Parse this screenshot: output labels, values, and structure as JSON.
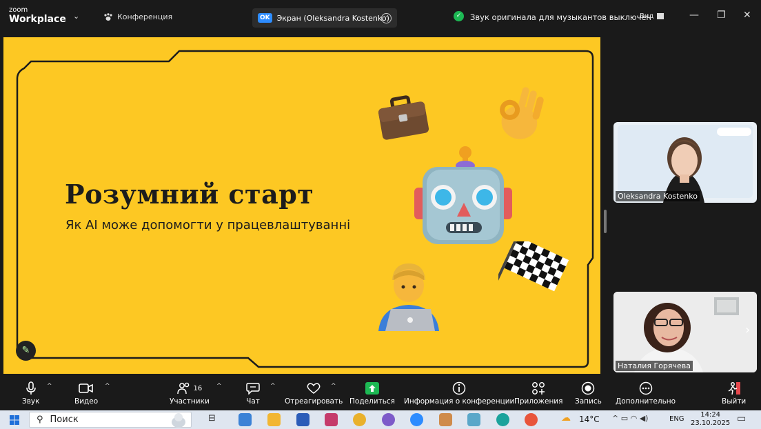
{
  "titlebar": {
    "brand_small": "zoom",
    "brand_big": "Workplace",
    "conference_label": "Конференция",
    "screen_badge": "OK",
    "screen_tab": "Экран (Oleksandra Kostenko)",
    "original_sound": "Звук оригинала для музыкантов выключен",
    "view_label": "Вид"
  },
  "slide": {
    "title": "Розумний старт",
    "subtitle": "Як AI може допомогти у працевлаштуванні"
  },
  "participants": [
    {
      "name": "Oleksandra Kostenko"
    },
    {
      "name": "Наталия Горячева"
    }
  ],
  "toolbar": {
    "audio": "Звук",
    "video": "Видео",
    "participants": "Участники",
    "participants_count": "16",
    "chat": "Чат",
    "react": "Отреагировать",
    "share": "Поделиться",
    "info": "Информация о конференции",
    "apps": "Приложения",
    "record": "Запись",
    "more": "Дополнительно",
    "leave": "Выйти"
  },
  "taskbar": {
    "search_placeholder": "Поиск",
    "weather": "14°C",
    "language": "ENG",
    "time": "14:24",
    "date": "23.10.2025"
  },
  "colors": {
    "slide_bg": "#fdc823",
    "accent_green": "#1db954",
    "zoom_blue": "#2d8cff",
    "leave_red": "#e5484d"
  }
}
